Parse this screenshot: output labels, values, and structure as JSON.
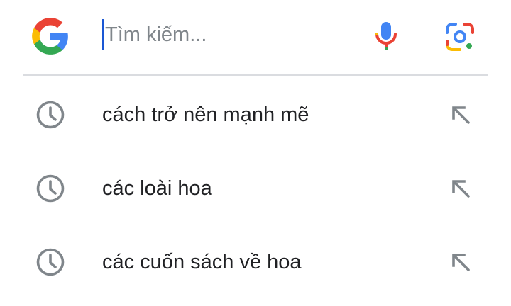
{
  "search": {
    "placeholder": "Tìm kiếm..."
  },
  "icons": {
    "logo": "google-g-logo",
    "voice": "microphone-icon",
    "lens": "google-lens-icon",
    "history": "clock-history-icon",
    "fill": "arrow-up-left-icon"
  },
  "colors": {
    "google_blue": "#4285F4",
    "google_red": "#EA4335",
    "google_yellow": "#FBBC05",
    "google_green": "#34A853",
    "caret": "#1A57D4",
    "icon_gray": "#80868B",
    "text": "#202124"
  },
  "suggestions": [
    {
      "text": "cách trở nên mạnh mẽ"
    },
    {
      "text": "các loài hoa"
    },
    {
      "text": "các cuốn sách về hoa"
    }
  ]
}
